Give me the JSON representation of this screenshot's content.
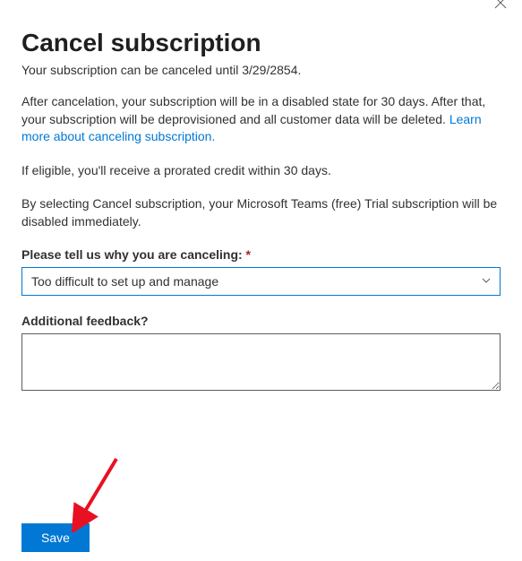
{
  "dialog": {
    "title": "Cancel subscription",
    "subtitle": "Your subscription can be canceled until 3/29/2854.",
    "para1_prefix": "After cancelation, your subscription will be in a disabled state for 30 days. After that, your subscription will be deprovisioned and all customer data will be deleted. ",
    "para1_link": "Learn more about canceling subscription.",
    "para2": "If eligible, you'll receive a prorated credit within 30 days.",
    "para3": "By selecting Cancel subscription, your Microsoft Teams (free) Trial subscription will be disabled immediately."
  },
  "form": {
    "reason_label": "Please tell us why you are canceling: ",
    "required_mark": "*",
    "reason_value": "Too difficult to set up and manage",
    "feedback_label": "Additional feedback?",
    "feedback_value": ""
  },
  "actions": {
    "save_label": "Save"
  }
}
